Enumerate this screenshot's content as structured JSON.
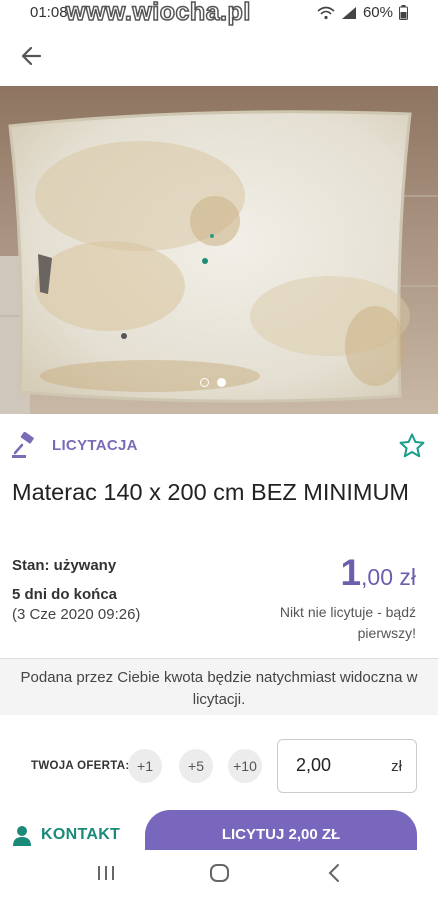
{
  "status": {
    "time": "01:08",
    "watermark": "www.wiocha.pl",
    "battery": "60%"
  },
  "listing": {
    "badge": "LICYTACJA",
    "title": "Materac 140 x 200 cm BEZ MINIMUM",
    "condition": "Stan: używany",
    "time_left": "5 dni do końca",
    "end_date": "(3 Cze 2020 09:26)",
    "price_main": "1",
    "price_rest": ",00 zł",
    "bid_status": "Nikt nie licytuje - bądź pierwszy!",
    "carousel_pages": 2,
    "carousel_active": 2
  },
  "notice": "Podana przez Ciebie kwota będzie natychmiast widoczna w licytacji.",
  "offer": {
    "label": "TWOJA OFERTA:",
    "increments": [
      "+1",
      "+5",
      "+10"
    ],
    "value": "2,00",
    "currency": "zł"
  },
  "actions": {
    "contact": "KONTAKT",
    "bid": "LICYTUJ 2,00 ZŁ"
  },
  "colors": {
    "accent": "#7967bd",
    "contact": "#1a8a7a",
    "price": "#6b5fae"
  }
}
